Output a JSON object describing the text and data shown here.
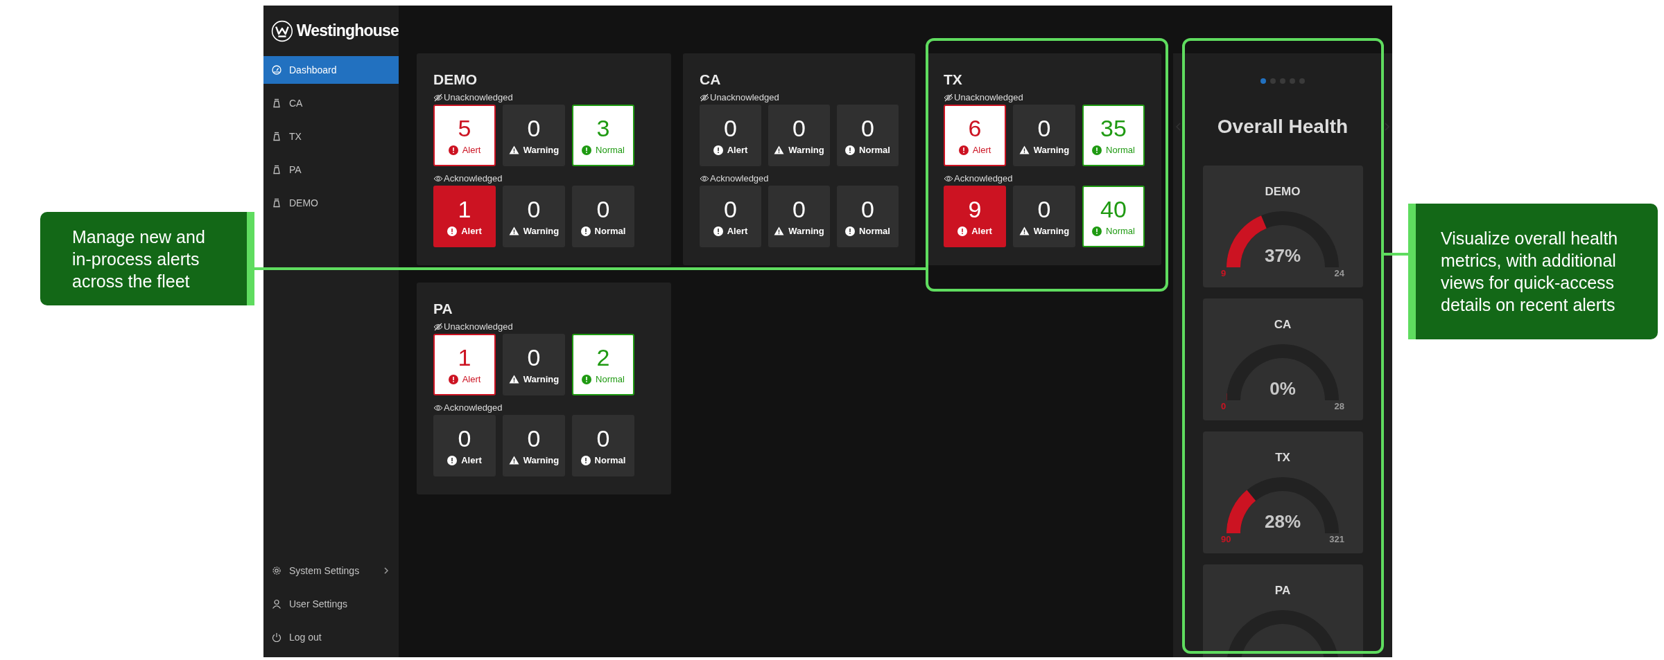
{
  "logo": {
    "text": "Westinghouse"
  },
  "sidebar": {
    "items": [
      {
        "label": "Dashboard",
        "kind": "dashboard",
        "selected": true
      },
      {
        "label": "CA",
        "kind": "site",
        "selected": false
      },
      {
        "label": "TX",
        "kind": "site",
        "selected": false
      },
      {
        "label": "PA",
        "kind": "site",
        "selected": false
      },
      {
        "label": "DEMO",
        "kind": "site",
        "selected": false
      }
    ],
    "footer": [
      {
        "label": "System Settings",
        "kind": "settings",
        "expandable": true
      },
      {
        "label": "User Settings",
        "kind": "user",
        "expandable": false
      },
      {
        "label": "Log out",
        "kind": "logout",
        "expandable": false
      }
    ]
  },
  "sites": [
    {
      "name": "DEMO",
      "groups": [
        {
          "label": "Unacknowledged",
          "kind": "unacknowledged",
          "tiles": [
            {
              "count": "5",
              "label": "Alert",
              "kind": "alert",
              "highlighted": true,
              "filled": false
            },
            {
              "count": "0",
              "label": "Warning",
              "kind": "warning",
              "highlighted": false,
              "filled": false
            },
            {
              "count": "3",
              "label": "Normal",
              "kind": "normal",
              "highlighted": true,
              "filled": false
            }
          ]
        },
        {
          "label": "Acknowledged",
          "kind": "acknowledged",
          "tiles": [
            {
              "count": "1",
              "label": "Alert",
              "kind": "alert",
              "highlighted": true,
              "filled": true
            },
            {
              "count": "0",
              "label": "Warning",
              "kind": "warning",
              "highlighted": false,
              "filled": false
            },
            {
              "count": "0",
              "label": "Normal",
              "kind": "normal",
              "highlighted": false,
              "filled": false
            }
          ]
        }
      ]
    },
    {
      "name": "CA",
      "groups": [
        {
          "label": "Unacknowledged",
          "kind": "unacknowledged",
          "tiles": [
            {
              "count": "0",
              "label": "Alert",
              "kind": "alert",
              "highlighted": false,
              "filled": false
            },
            {
              "count": "0",
              "label": "Warning",
              "kind": "warning",
              "highlighted": false,
              "filled": false
            },
            {
              "count": "0",
              "label": "Normal",
              "kind": "normal",
              "highlighted": false,
              "filled": false
            }
          ]
        },
        {
          "label": "Acknowledged",
          "kind": "acknowledged",
          "tiles": [
            {
              "count": "0",
              "label": "Alert",
              "kind": "alert",
              "highlighted": false,
              "filled": false
            },
            {
              "count": "0",
              "label": "Warning",
              "kind": "warning",
              "highlighted": false,
              "filled": false
            },
            {
              "count": "0",
              "label": "Normal",
              "kind": "normal",
              "highlighted": false,
              "filled": false
            }
          ]
        }
      ]
    },
    {
      "name": "TX",
      "groups": [
        {
          "label": "Unacknowledged",
          "kind": "unacknowledged",
          "tiles": [
            {
              "count": "6",
              "label": "Alert",
              "kind": "alert",
              "highlighted": true,
              "filled": false
            },
            {
              "count": "0",
              "label": "Warning",
              "kind": "warning",
              "highlighted": false,
              "filled": false
            },
            {
              "count": "35",
              "label": "Normal",
              "kind": "normal",
              "highlighted": true,
              "filled": false
            }
          ]
        },
        {
          "label": "Acknowledged",
          "kind": "acknowledged",
          "tiles": [
            {
              "count": "9",
              "label": "Alert",
              "kind": "alert",
              "highlighted": true,
              "filled": true
            },
            {
              "count": "0",
              "label": "Warning",
              "kind": "warning",
              "highlighted": false,
              "filled": false
            },
            {
              "count": "40",
              "label": "Normal",
              "kind": "normal",
              "highlighted": true,
              "filled": false
            }
          ]
        }
      ]
    },
    {
      "name": "PA",
      "groups": [
        {
          "label": "Unacknowledged",
          "kind": "unacknowledged",
          "tiles": [
            {
              "count": "1",
              "label": "Alert",
              "kind": "alert",
              "highlighted": true,
              "filled": false
            },
            {
              "count": "0",
              "label": "Warning",
              "kind": "warning",
              "highlighted": false,
              "filled": false
            },
            {
              "count": "2",
              "label": "Normal",
              "kind": "normal",
              "highlighted": true,
              "filled": false
            }
          ]
        },
        {
          "label": "Acknowledged",
          "kind": "acknowledged",
          "tiles": [
            {
              "count": "0",
              "label": "Alert",
              "kind": "alert",
              "highlighted": false,
              "filled": false
            },
            {
              "count": "0",
              "label": "Warning",
              "kind": "warning",
              "highlighted": false,
              "filled": false
            },
            {
              "count": "0",
              "label": "Normal",
              "kind": "normal",
              "highlighted": false,
              "filled": false
            }
          ]
        }
      ]
    }
  ],
  "health": {
    "title": "Overall Health",
    "pages": [
      {
        "selected": true
      },
      {
        "selected": false
      },
      {
        "selected": false
      },
      {
        "selected": false
      },
      {
        "selected": false
      }
    ],
    "gauges": [
      {
        "name": "DEMO",
        "reading": "37%",
        "level": 0.375,
        "min": "9",
        "max": "24"
      },
      {
        "name": "CA",
        "reading": "0%",
        "level": 0,
        "min": "0",
        "max": "28"
      },
      {
        "name": "TX",
        "reading": "28%",
        "level": 0.28,
        "min": "90",
        "max": "321"
      },
      {
        "name": "PA"
      }
    ]
  },
  "callouts": [
    {
      "text": "Manage new and in-process alerts across the fleet",
      "kind": "left"
    },
    {
      "text": "Visualize overall health metrics, with additional views for quick-access details on recent alerts",
      "kind": "right"
    }
  ]
}
